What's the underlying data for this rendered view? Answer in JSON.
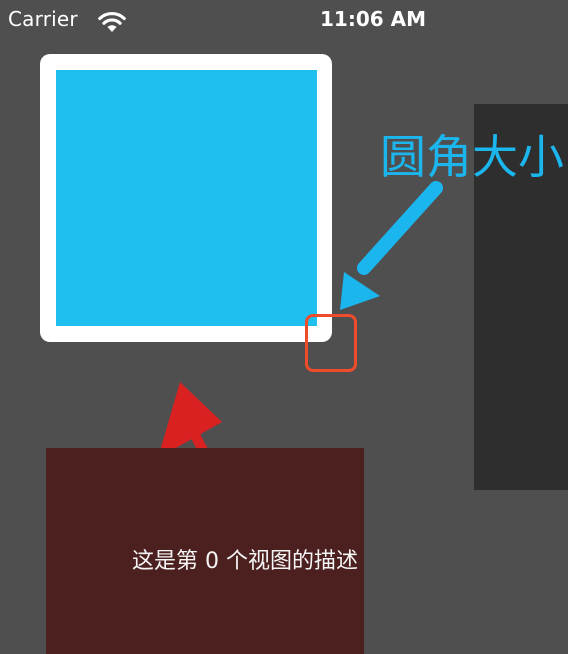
{
  "status_bar": {
    "carrier": "Carrier",
    "time": "11:06 AM",
    "wifi_icon": "wifi-icon"
  },
  "annotation": {
    "label": "圆角大小"
  },
  "bottom_card": {
    "caption": "这是第 0 个视图的描述"
  },
  "colors": {
    "background": "#4f4f4f",
    "card_frame": "#ffffff",
    "card_inner": "#1fbff0",
    "right_panel": "#2e2e2e",
    "annotation_blue": "#1cb6ee",
    "highlight_red": "#f04b2a",
    "bottom_card": "#4d2020"
  }
}
